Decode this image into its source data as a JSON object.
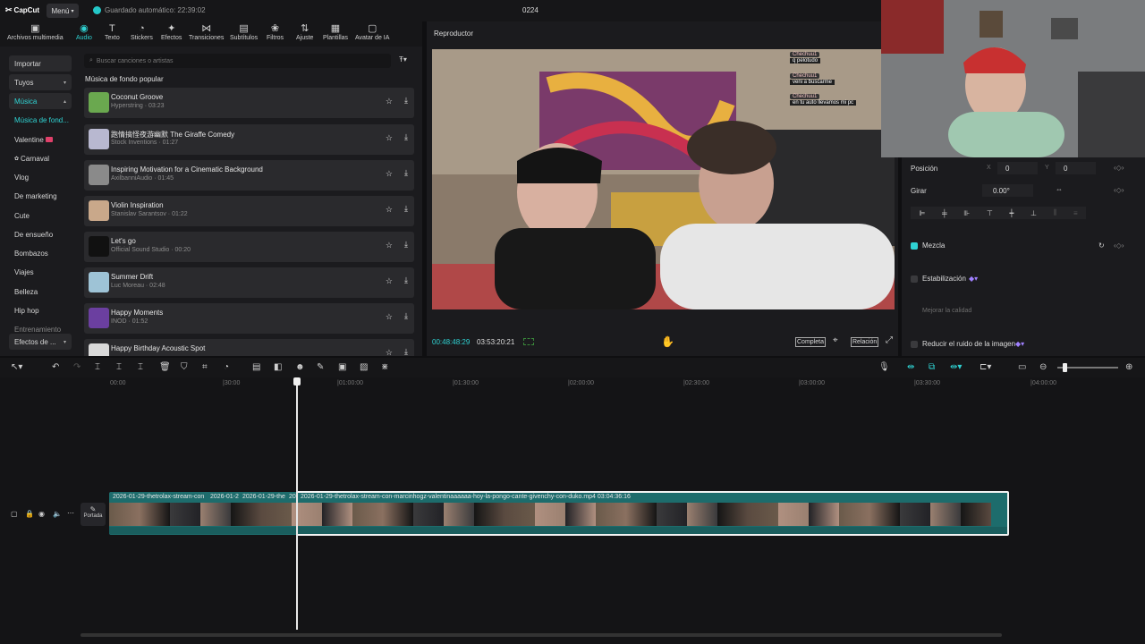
{
  "app": {
    "logo": "CapCut",
    "menu_label": "Menú",
    "autosave": "Guardado automático: 22:39:02",
    "project_title": "0224"
  },
  "toolbar": [
    {
      "label": "Archivos multimedia",
      "icon": "media-icon"
    },
    {
      "label": "Audio",
      "icon": "audio-icon",
      "active": true
    },
    {
      "label": "Texto",
      "icon": "text-icon"
    },
    {
      "label": "Stickers",
      "icon": "sticker-icon"
    },
    {
      "label": "Efectos",
      "icon": "effects-icon"
    },
    {
      "label": "Transiciones",
      "icon": "transitions-icon"
    },
    {
      "label": "Subtítulos",
      "icon": "subtitles-icon"
    },
    {
      "label": "Filtros",
      "icon": "filters-icon"
    },
    {
      "label": "Ajuste",
      "icon": "adjust-icon"
    },
    {
      "label": "Plantillas",
      "icon": "templates-icon"
    },
    {
      "label": "Avatar de IA",
      "icon": "ai-avatar-icon"
    }
  ],
  "sidenav": [
    {
      "label": "Importar"
    },
    {
      "label": "Tuyos"
    },
    {
      "label": "Música"
    },
    {
      "label": "Música de fond..."
    },
    {
      "label": "Valentine"
    },
    {
      "label": "Carnaval"
    },
    {
      "label": "Vlog"
    },
    {
      "label": "De marketing"
    },
    {
      "label": "Cute"
    },
    {
      "label": "De ensueño"
    },
    {
      "label": "Bombazos"
    },
    {
      "label": "Viajes"
    },
    {
      "label": "Belleza"
    },
    {
      "label": "Hip hop"
    },
    {
      "label": "Entrenamiento"
    },
    {
      "label": "Efectos de ..."
    }
  ],
  "search": {
    "placeholder": "Buscar canciones o artistas"
  },
  "section_title": "Música de fondo popular",
  "tracks": [
    {
      "name": "Coconut Groove",
      "meta": "Hyperstring · 03:23",
      "color": "#6aa84f"
    },
    {
      "name": "跑情搞怪夜游幽默  The Giraffe Comedy",
      "meta": "Stock Inventions · 01:27",
      "color": "#b8b8d0"
    },
    {
      "name": "Inspiring Motivation for a Cinematic Background",
      "meta": "AxilbanniAudio · 01:45",
      "color": "#8a8a8a"
    },
    {
      "name": "Violin Inspiration",
      "meta": "Stanislav Sarantsov · 01:22",
      "color": "#c9a88a"
    },
    {
      "name": "Let's go",
      "meta": "Official Sound Studio · 00:20",
      "color": "#111111"
    },
    {
      "name": "Summer Drift",
      "meta": "Luc Moreau · 02:48",
      "color": "#9ec3d6"
    },
    {
      "name": "Happy Moments",
      "meta": "INOD · 01:52",
      "color": "#6b3fa0"
    },
    {
      "name": "Happy Birthday Acoustic Spot",
      "meta": "",
      "color": "#d9d9d9"
    }
  ],
  "player": {
    "label": "Reproductor",
    "time_current": "00:48:48:29",
    "time_total": "03:53:20:21",
    "btn_full": "Completa",
    "btn_ratio": "Relación"
  },
  "chat": [
    {
      "user": "Chechuu1",
      "msg": "q pelotudo"
    },
    {
      "user": "Chechuu1",
      "msg": "veni a buscarme"
    },
    {
      "user": "Chechuu1",
      "msg": "en tu auto llevamos mi pc"
    }
  ],
  "props": {
    "position_label": "Posición",
    "x_label": "X",
    "x_value": "0",
    "y_label": "Y",
    "y_value": "0",
    "rotate_label": "Girar",
    "rotate_value": "0.00°",
    "blend_label": "Mezcla",
    "stabilize_label": "Estabilización",
    "improve_label": "Mejorar la calidad",
    "denoise_label": "Reducir el ruido de la imagen"
  },
  "timeline": {
    "ticks": [
      "00:00",
      "|30:00",
      "|01:00:00",
      "|01:30:00",
      "|02:00:00",
      "|02:30:00",
      "|03:00:00",
      "|03:30:00",
      "|04:00:00"
    ],
    "cover_label": "Portada",
    "clip_labels": [
      "2026-01-29-thetrolax-stream-con",
      "2026-01-2",
      "2026-01-29-the",
      "20",
      "2026-01-29-thetrolax-stream-con-marcinhogz-valentinaaaaaa-hoy-la-pongo-cante-givenchy-con-duko.mp4  03:04:36:16"
    ]
  }
}
